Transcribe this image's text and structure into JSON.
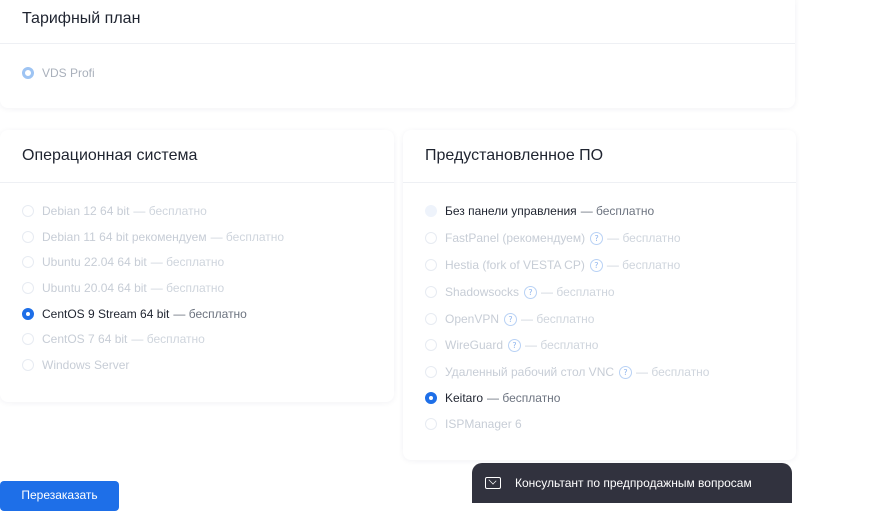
{
  "tariff": {
    "title": "Тарифный план",
    "option": "VDS Profi"
  },
  "os": {
    "title": "Операционная система",
    "options": [
      {
        "label": "Debian 12 64 bit",
        "free": "— бесплатно"
      },
      {
        "label": "Debian 11 64 bit рекомендуем",
        "free": "— бесплатно"
      },
      {
        "label": "Ubuntu 22.04 64 bit",
        "free": "— бесплатно"
      },
      {
        "label": "Ubuntu 20.04 64 bit",
        "free": "— бесплатно"
      },
      {
        "label": "CentOS 9 Stream 64 bit",
        "free": "— бесплатно"
      },
      {
        "label": "CentOS 7 64 bit",
        "free": "— бесплатно"
      },
      {
        "label": "Windows Server",
        "free": ""
      }
    ],
    "selected": "CentOS 9 Stream 64 bit"
  },
  "software": {
    "title": "Предустановленное ПО",
    "options": [
      {
        "label": "Без панели управления",
        "free": "— бесплатно"
      },
      {
        "label": "FastPanel (рекомендуем)",
        "free": "— бесплатно",
        "help": "?"
      },
      {
        "label": "Hestia (fork of VESTA CP)",
        "free": "— бесплатно",
        "help": "?"
      },
      {
        "label": "Shadowsocks",
        "free": "— бесплатно",
        "help": "?"
      },
      {
        "label": "OpenVPN",
        "free": "— бесплатно",
        "help": "?"
      },
      {
        "label": "WireGuard",
        "free": "— бесплатно",
        "help": "?"
      },
      {
        "label": "Удаленный рабочий стол VNC",
        "free": "— бесплатно",
        "help": "?"
      },
      {
        "label": "Keitaro",
        "free": "— бесплатно"
      },
      {
        "label": "ISPManager 6",
        "free": ""
      }
    ],
    "selected": "Keitaro"
  },
  "chat": {
    "label": "Консультант по предпродажным вопросам",
    "icon": "mail-icon"
  },
  "cta": {
    "label": "Перезаказать"
  },
  "colors": {
    "accent": "#1e6fe8",
    "chat_bg": "#31323e"
  }
}
